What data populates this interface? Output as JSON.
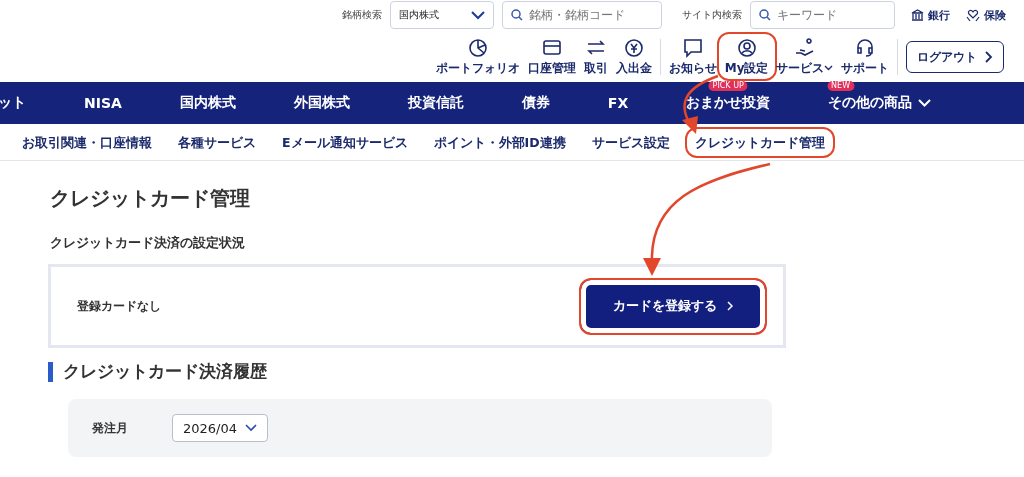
{
  "header": {
    "stock_search": {
      "label": "銘柄検索",
      "market": "国内株式",
      "placeholder": "銘柄・銘柄コード"
    },
    "site_search": {
      "label": "サイト内検索",
      "placeholder": "キーワード"
    },
    "links": [
      {
        "kind": "bank",
        "label": "銀行"
      },
      {
        "kind": "insurance",
        "label": "保険"
      }
    ],
    "icon_menu": [
      {
        "kind": "portfolio",
        "label": "ポートフォリオ",
        "highlighted": false
      },
      {
        "kind": "account",
        "label": "口座管理",
        "highlighted": false
      },
      {
        "kind": "trade",
        "label": "取引",
        "highlighted": false
      },
      {
        "kind": "money",
        "label": "入出金",
        "highlighted": false
      },
      {
        "kind": "notice",
        "label": "お知らせ",
        "highlighted": false
      },
      {
        "kind": "mysettings",
        "label": "My設定",
        "highlighted": true
      },
      {
        "kind": "service",
        "label": "サービス",
        "highlighted": false
      },
      {
        "kind": "support",
        "label": "サポート",
        "highlighted": false
      }
    ],
    "logout": "ログアウト"
  },
  "main_nav": [
    {
      "label": "ット"
    },
    {
      "label": "NISA"
    },
    {
      "label": "国内株式"
    },
    {
      "label": "外国株式"
    },
    {
      "label": "投資信託"
    },
    {
      "label": "債券"
    },
    {
      "label": "FX"
    },
    {
      "label": "おまかせ投資",
      "badge": "PICK UP"
    },
    {
      "label": "その他の商品",
      "badge": "NEW",
      "dropdown": true
    }
  ],
  "sub_nav": [
    {
      "label": "お取引関連・口座情報",
      "highlighted": false
    },
    {
      "label": "各種サービス",
      "highlighted": false
    },
    {
      "label": "Eメール通知サービス",
      "highlighted": false
    },
    {
      "label": "ポイント・外部ID連携",
      "highlighted": false
    },
    {
      "label": "サービス設定",
      "highlighted": false
    },
    {
      "label": "クレジットカード管理",
      "highlighted": true
    }
  ],
  "page": {
    "title": "クレジットカード管理",
    "status_heading": "クレジットカード決済の設定状況",
    "status_text": "登録カードなし",
    "register_button": {
      "label": "カードを登録する",
      "highlighted": true
    },
    "history_heading": "クレジットカード決済履歴",
    "filter": {
      "label": "発注月",
      "value": "2026/04"
    }
  }
}
